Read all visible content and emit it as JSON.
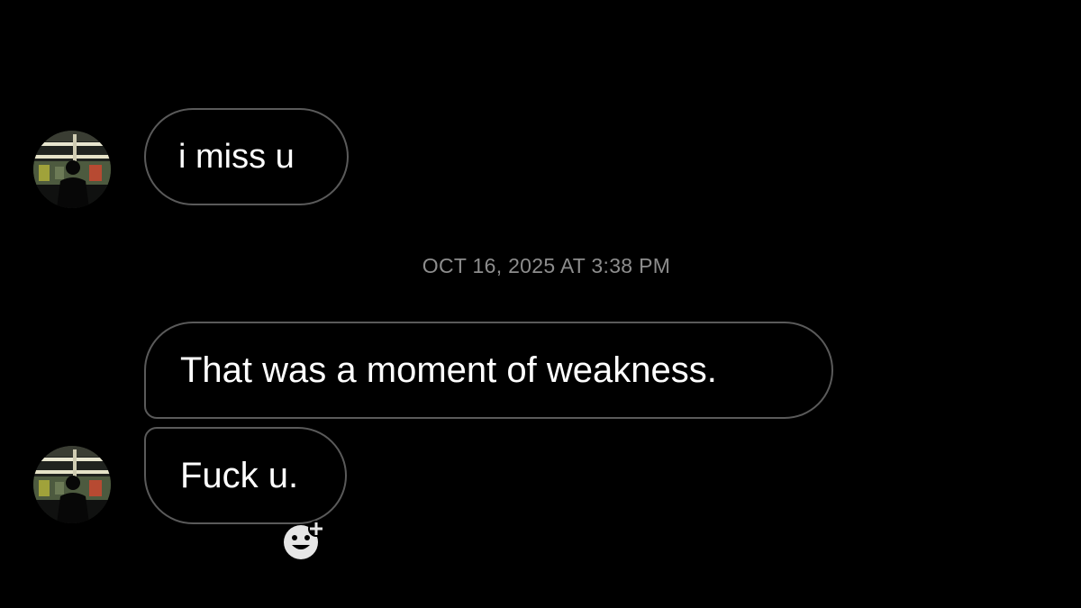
{
  "conversation": {
    "messages": [
      {
        "text": "i miss u"
      },
      {
        "text": "That was a moment of weakness."
      },
      {
        "text": "Fuck u."
      }
    ],
    "timestamp": "OCT 16, 2025 AT 3:38 PM"
  },
  "icons": {
    "avatar": "contact-avatar-photo",
    "reaction": "add-reaction-smiley-plus-icon"
  },
  "colors": {
    "background": "#000000",
    "bubble_border": "#5a5a5a",
    "message_text": "#ffffff",
    "timestamp_text": "#8d8d8d",
    "reaction_icon": "#e6e6e6"
  }
}
